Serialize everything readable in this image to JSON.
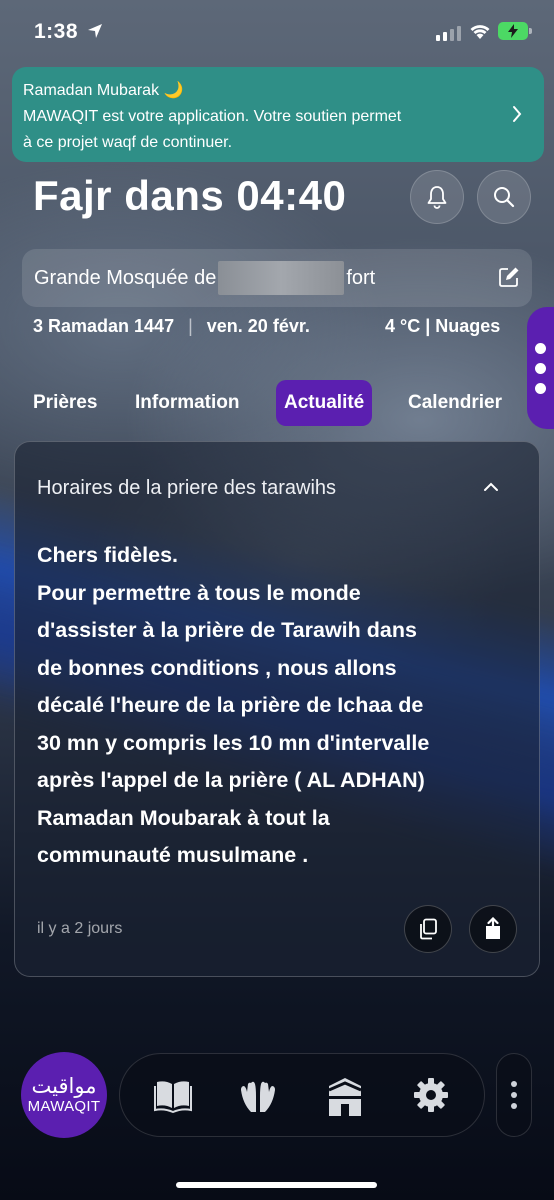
{
  "status_bar": {
    "time": "1:38",
    "icons": [
      "location-arrow-icon",
      "signal-icon",
      "wifi-icon",
      "battery-charging-icon"
    ]
  },
  "banner": {
    "line1": "Ramadan Mubarak 🌙",
    "line2": "MAWAQIT est votre application. Votre soutien permet",
    "line3": "à ce projet waqf de continuer."
  },
  "header": {
    "next_prayer": "Fajr dans 04:40",
    "icons": [
      "bell-icon",
      "search-icon"
    ]
  },
  "mosque": {
    "name_start": "Grande Mosquée de",
    "name_end": "fort"
  },
  "info": {
    "hijri_date": "3 Ramadan 1447",
    "separator": "|",
    "gregorian_date": "ven. 20 févr.",
    "weather": "4 °C | Nuages"
  },
  "tabs": [
    {
      "label": "Prières"
    },
    {
      "label": "Information"
    },
    {
      "label": "Actualité",
      "active": true
    },
    {
      "label": "Calendrier"
    }
  ],
  "news": {
    "title": "Horaires de la priere des tarawihs",
    "body": "Chers fidèles.\nPour permettre à tous le monde\nd'assister à la prière de Tarawih dans\nde bonnes conditions , nous allons\ndécalé l'heure de la prière de Ichaa de\n30 mn y compris les 10 mn d'intervalle\naprès l'appel de la prière ( AL ADHAN)\nRamadan Moubarak à tout la\ncommunauté musulmane .",
    "posted": "il y a 2 jours"
  },
  "bottom_nav": {
    "logo_arabic": "مواقيت",
    "logo_text": "MAWAQIT",
    "items": [
      "quran-icon",
      "dua-hands-icon",
      "kaaba-icon",
      "settings-gear-icon",
      "more-dots-icon"
    ]
  },
  "colors": {
    "accent": "#5b1fb0",
    "banner": "#2f8f87"
  }
}
